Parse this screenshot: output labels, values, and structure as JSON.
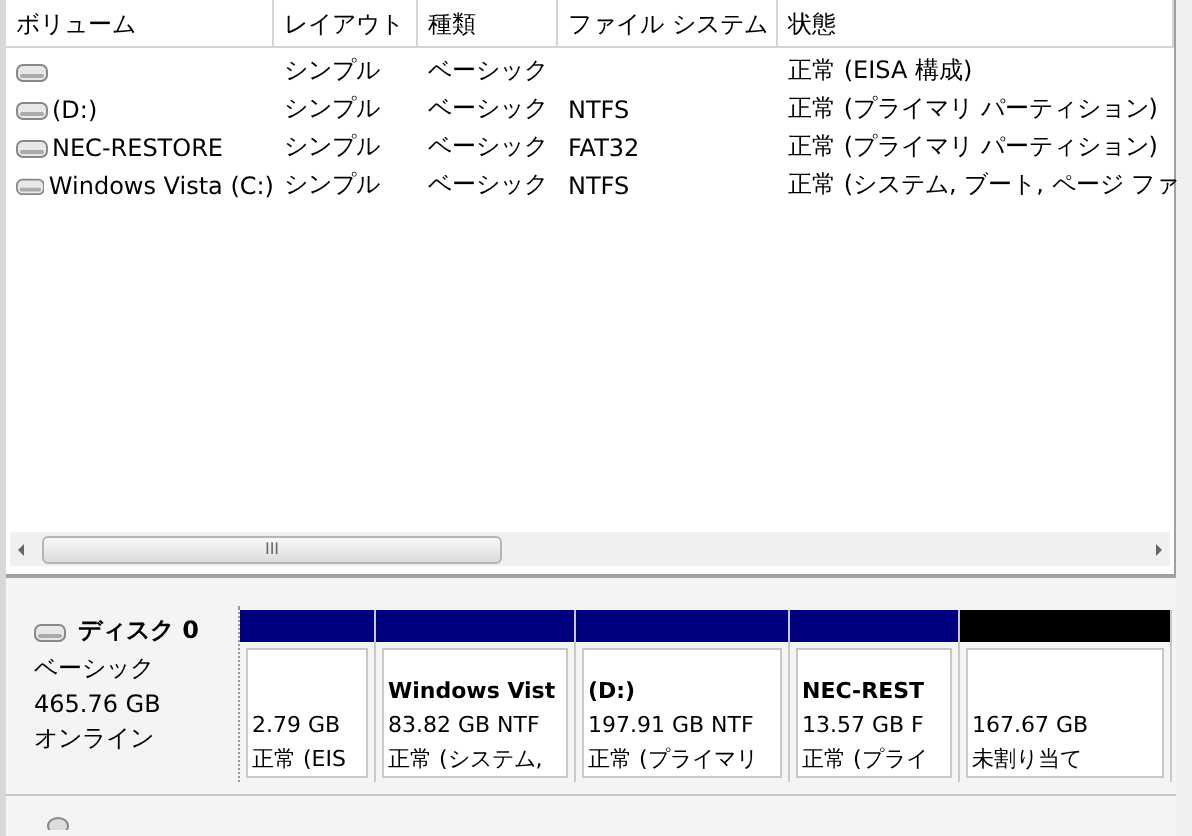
{
  "volume_list": {
    "columns": [
      "ボリューム",
      "レイアウト",
      "種類",
      "ファイル システム",
      "状態"
    ],
    "rows": [
      {
        "layout": "シンプル",
        "type": "ベーシック",
        "status": "正常 (EISA 構成)"
      },
      {
        "volume": "(D:)",
        "layout": "シンプル",
        "type": "ベーシック",
        "file_system": "NTFS",
        "status": "正常 (プライマリ パーティション)"
      },
      {
        "volume": "NEC-RESTORE",
        "layout": "シンプル",
        "type": "ベーシック",
        "file_system": "FAT32",
        "status": "正常 (プライマリ パーティション)"
      },
      {
        "volume": "Windows Vista (C:)",
        "layout": "シンプル",
        "type": "ベーシック",
        "file_system": "NTFS",
        "status": "正常 (システム, ブート, ページ ファ"
      }
    ],
    "scrollbar_grip": "III"
  },
  "disk": {
    "name": "ディスク 0",
    "type": "ベーシック",
    "size": "465.76 GB",
    "state": "オンライン",
    "partitions": [
      {
        "size": "2.79 GB",
        "status": "正常 (EIS",
        "color": "#000080"
      },
      {
        "name": "Windows Vist",
        "size": "83.82 GB NTF",
        "status": "正常 (システム,",
        "color": "#000080"
      },
      {
        "name": "(D:)",
        "size": "197.91 GB NTF",
        "status": "正常 (プライマリ",
        "color": "#000080"
      },
      {
        "name": "NEC-REST",
        "size": "13.57 GB F",
        "status": "正常 (プライ",
        "color": "#000080"
      },
      {
        "size": "167.67 GB",
        "status": "未割り当て",
        "color": "#000000"
      }
    ]
  }
}
